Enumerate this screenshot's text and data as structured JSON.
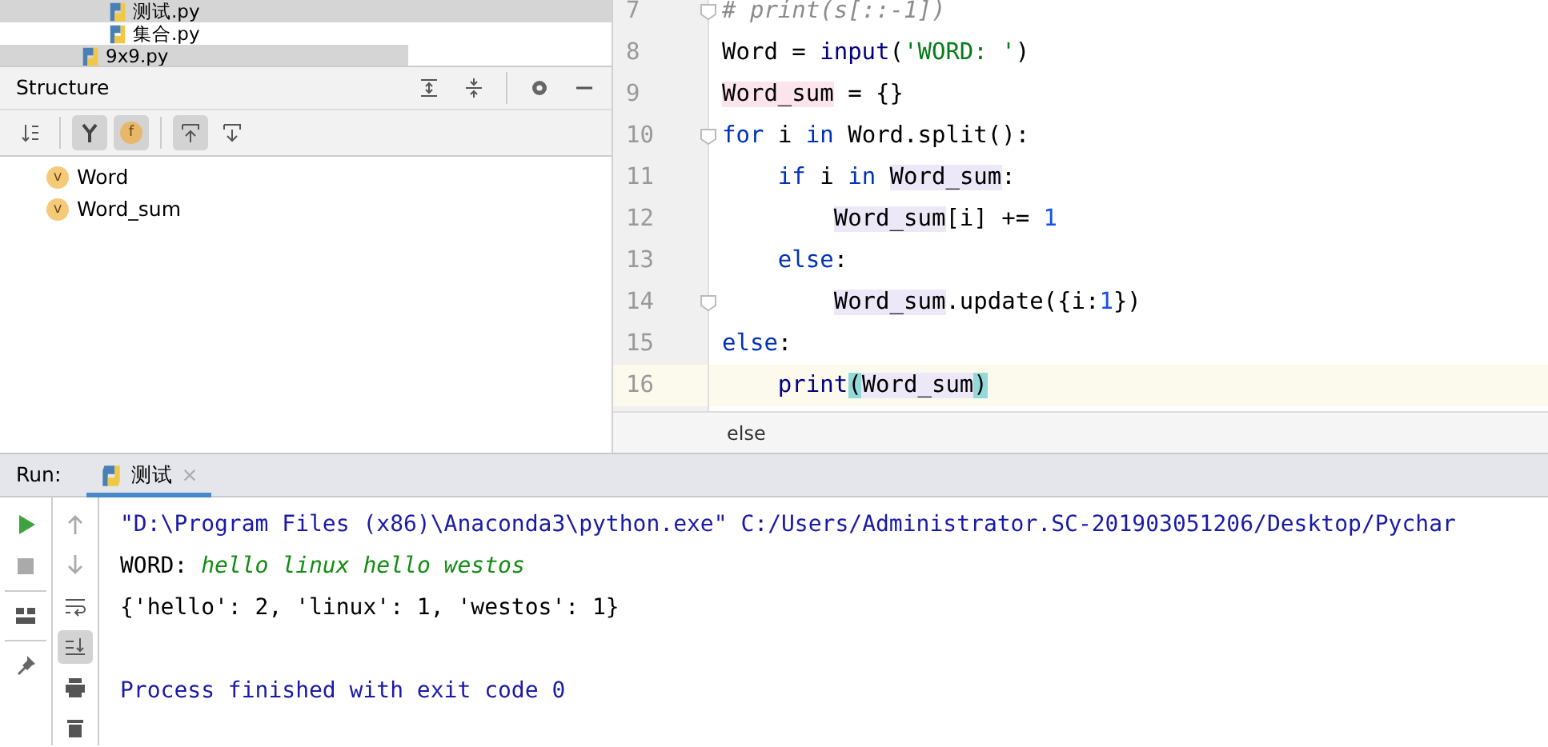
{
  "project_tree": [
    {
      "children": [
        {
          "name": "测试.py",
          "highlighted": true
        },
        {
          "name": "集合.py",
          "highlighted": false
        }
      ]
    },
    {
      "name": "9x9.py",
      "highlighted": true
    }
  ],
  "structure": {
    "title": "Structure",
    "toolbar": [
      {
        "kind": "sort",
        "selected": false
      },
      {
        "kind": "fields",
        "selected": true
      },
      {
        "kind": "letter",
        "label": "f",
        "selected": true
      },
      {
        "kind": "autoscroll-to",
        "selected": true
      },
      {
        "kind": "autoscroll-from",
        "selected": false
      }
    ],
    "items": [
      {
        "badge": "v",
        "name": "Word"
      },
      {
        "badge": "v",
        "name": "Word_sum"
      }
    ]
  },
  "editor": {
    "lines": [
      {
        "number": "7",
        "current": false,
        "fold": true,
        "tokens": [
          {
            "text": "# print(s[::-1])",
            "kind": "comment"
          }
        ]
      },
      {
        "number": "8",
        "current": false,
        "fold": false,
        "tokens": [
          {
            "text": "Word = ",
            "kind": "plain"
          },
          {
            "text": "input",
            "kind": "builtin"
          },
          {
            "text": "(",
            "kind": "plain"
          },
          {
            "text": "'WORD: '",
            "kind": "string"
          },
          {
            "text": ")",
            "kind": "plain"
          }
        ]
      },
      {
        "number": "9",
        "current": false,
        "fold": false,
        "tokens": [
          {
            "text": "Word_sum",
            "kind": "plain",
            "color": "#fce4ec"
          },
          {
            "text": " = {}",
            "kind": "plain"
          }
        ]
      },
      {
        "number": "10",
        "current": false,
        "fold": true,
        "tokens": [
          {
            "text": "for",
            "kind": "keyword"
          },
          {
            "text": " i ",
            "kind": "plain"
          },
          {
            "text": "in",
            "kind": "keyword"
          },
          {
            "text": " Word.split():",
            "kind": "plain"
          }
        ]
      },
      {
        "number": "11",
        "current": false,
        "fold": false,
        "tokens": [
          {
            "text": "    if",
            "kind": "keyword"
          },
          {
            "text": " i ",
            "kind": "plain"
          },
          {
            "text": "in ",
            "kind": "keyword"
          },
          {
            "text": "Word_sum",
            "kind": "plain",
            "color": "#ece8f8"
          },
          {
            "text": ":",
            "kind": "plain"
          }
        ]
      },
      {
        "number": "12",
        "current": false,
        "fold": false,
        "tokens": [
          {
            "text": "        Word_sum",
            "kind": "plain",
            "color": "#ece8f8"
          },
          {
            "text": "[i] += ",
            "kind": "plain"
          },
          {
            "text": "1",
            "kind": "number"
          }
        ]
      },
      {
        "number": "13",
        "current": false,
        "fold": false,
        "tokens": [
          {
            "text": "    else",
            "kind": "keyword"
          },
          {
            "text": ":",
            "kind": "plain"
          }
        ]
      },
      {
        "number": "14",
        "current": false,
        "fold": true,
        "tokens": [
          {
            "text": "        Word_sum",
            "kind": "plain",
            "color": "#ece8f8"
          },
          {
            "text": ".update({i:",
            "kind": "plain"
          },
          {
            "text": "1",
            "kind": "number"
          },
          {
            "text": "})",
            "kind": "plain"
          }
        ]
      },
      {
        "number": "15",
        "current": false,
        "fold": false,
        "tokens": [
          {
            "text": "else",
            "kind": "keyword"
          },
          {
            "text": ":",
            "kind": "plain"
          }
        ]
      },
      {
        "number": "16",
        "current": true,
        "fold": false,
        "tokens": [
          {
            "text": "    print",
            "kind": "builtin"
          },
          {
            "text": "(",
            "kind": "plain",
            "color": "#93d9d9"
          },
          {
            "text": "Word_sum",
            "kind": "plain",
            "color": "#ece8f8"
          },
          {
            "text": ")",
            "kind": "plain",
            "color": "#93d9d9"
          }
        ]
      }
    ],
    "breadcrumb": "else"
  },
  "run": {
    "label": "Run:",
    "tabs": [
      {
        "title": "测试",
        "close": "×",
        "selected": true
      }
    ],
    "right_tools": [
      {
        "selected": false
      },
      {
        "selected": false
      },
      {
        "selected": false
      },
      {
        "selected": true
      },
      {
        "selected": false
      },
      {
        "selected": false
      }
    ],
    "console": [
      {
        "kind": "command",
        "text": "\"D:\\Program Files (x86)\\Anaconda3\\python.exe\" C:/Users/Administrator.SC-201903051206/Desktop/Pychar"
      },
      {
        "kind": "input",
        "prompt": "WORD: ",
        "text": "hello linux hello westos"
      },
      {
        "kind": "output",
        "text": "{'hello': 2, 'linux': 1, 'westos': 1}"
      },
      {
        "kind": "blank"
      },
      {
        "kind": "exit",
        "text": "Process finished with exit code 0"
      }
    ]
  }
}
